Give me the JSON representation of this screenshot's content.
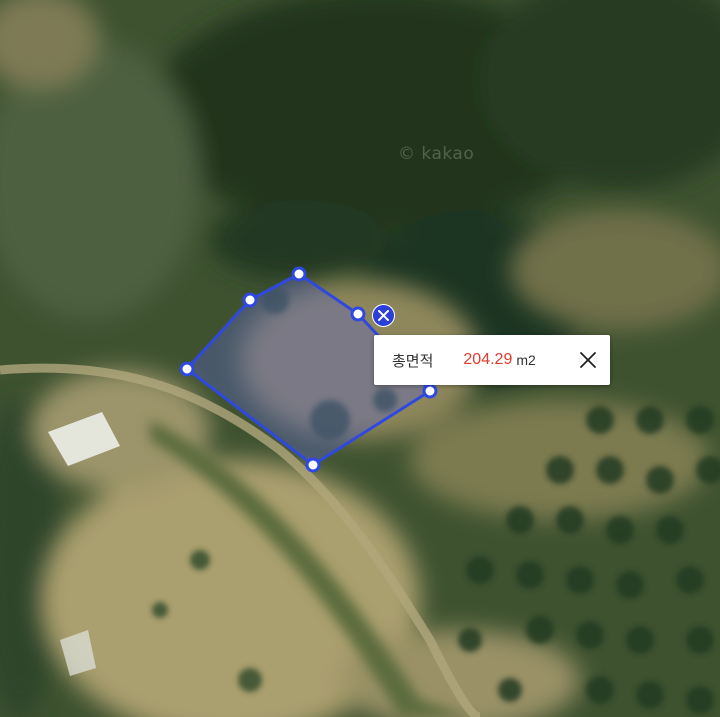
{
  "map": {
    "watermark": "© kakao"
  },
  "measure": {
    "label_title": "총면적",
    "area_value": "204.29",
    "area_unit": "m2",
    "line_color": "#2f49e0",
    "fill_color": "rgba(90,100,200,0.38)"
  },
  "icons": {
    "delete": "close-circle-icon",
    "close": "close-icon"
  }
}
